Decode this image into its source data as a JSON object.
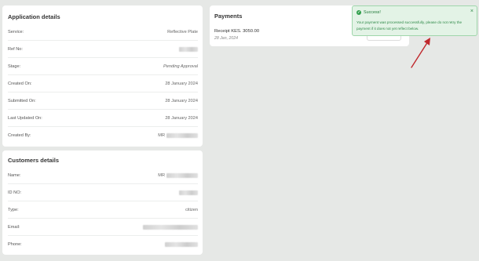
{
  "application": {
    "title": "Application details",
    "rows": [
      {
        "label": "Service:",
        "value": "Reflective Plate"
      },
      {
        "label": "Ref No:",
        "value": ""
      },
      {
        "label": "Stage:",
        "value": "Pending Approval"
      },
      {
        "label": "Created On:",
        "value": "28 January 2024"
      },
      {
        "label": "Submitted On:",
        "value": "28 January 2024"
      },
      {
        "label": "Last Updated On:",
        "value": "28 January 2024"
      },
      {
        "label": "Created By:",
        "value": "MR"
      }
    ]
  },
  "customer": {
    "title": "Customers details",
    "rows": [
      {
        "label": "Name:",
        "value": "MR"
      },
      {
        "label": "ID NO:",
        "value": ""
      },
      {
        "label": "Type:",
        "value": "citizen"
      },
      {
        "label": "Email:",
        "value": ""
      },
      {
        "label": "Phone:",
        "value": ""
      }
    ]
  },
  "payments": {
    "title": "Payments",
    "receipt": "Receipt KES. 3050.00",
    "date": "28 Jan, 2024"
  },
  "toast": {
    "title": "Success!",
    "message": "Your payment was processed successfully, please do not retry the payment if it does not yet reflect below.",
    "close": "×",
    "icon": "check-circle-icon"
  },
  "colors": {
    "background": "#e6e8e6",
    "toast_bg": "#e3f3e6",
    "toast_border": "#9fd6ab",
    "toast_text": "#2f8a48",
    "annotation_arrow": "#c0282d"
  }
}
